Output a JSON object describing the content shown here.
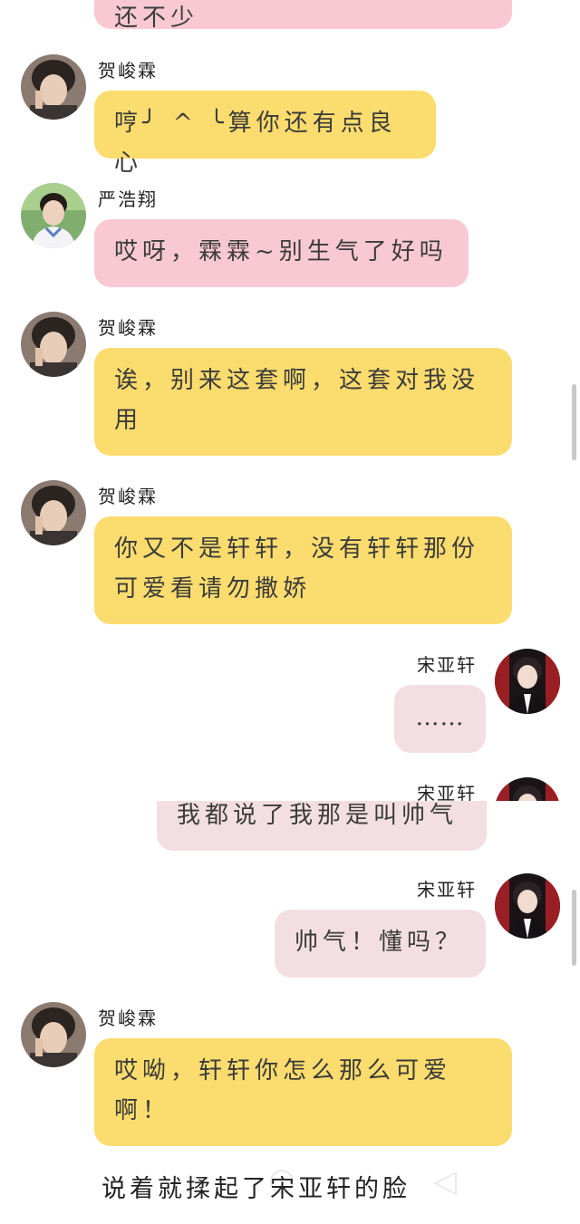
{
  "chat": {
    "partial_top_text": "还不少",
    "messages": [
      {
        "sender": "贺峻霖",
        "text": "哼╯ ^ ╰算你还有点良心"
      },
      {
        "sender": "严浩翔",
        "text": "哎呀，霖霖~别生气了好吗"
      },
      {
        "sender": "贺峻霖",
        "text": "诶，别来这套啊，这套对我没用"
      },
      {
        "sender": "贺峻霖",
        "text": "你又不是轩轩，没有轩轩那份可爱看请勿撒娇"
      },
      {
        "sender": "宋亚轩",
        "text": "……"
      },
      {
        "sender": "宋亚轩",
        "text": "我都说了我那是叫帅气"
      },
      {
        "sender": "宋亚轩",
        "text": "帅气！懂吗？"
      },
      {
        "sender": "贺峻霖",
        "text": "哎呦，轩轩你怎么那么可爱啊！"
      }
    ]
  },
  "narration": "说着就揉起了宋亚轩的脸",
  "colors": {
    "he_bubble": "#fbdc6e",
    "yan_bubble": "#f9c9d3",
    "song_bubble": "#f3dfe1"
  },
  "icons": {
    "avatar_he": "person-avatar-icon",
    "avatar_yan": "person-avatar-icon",
    "avatar_song": "person-avatar-icon",
    "nav_back": "triangle-left-icon"
  }
}
